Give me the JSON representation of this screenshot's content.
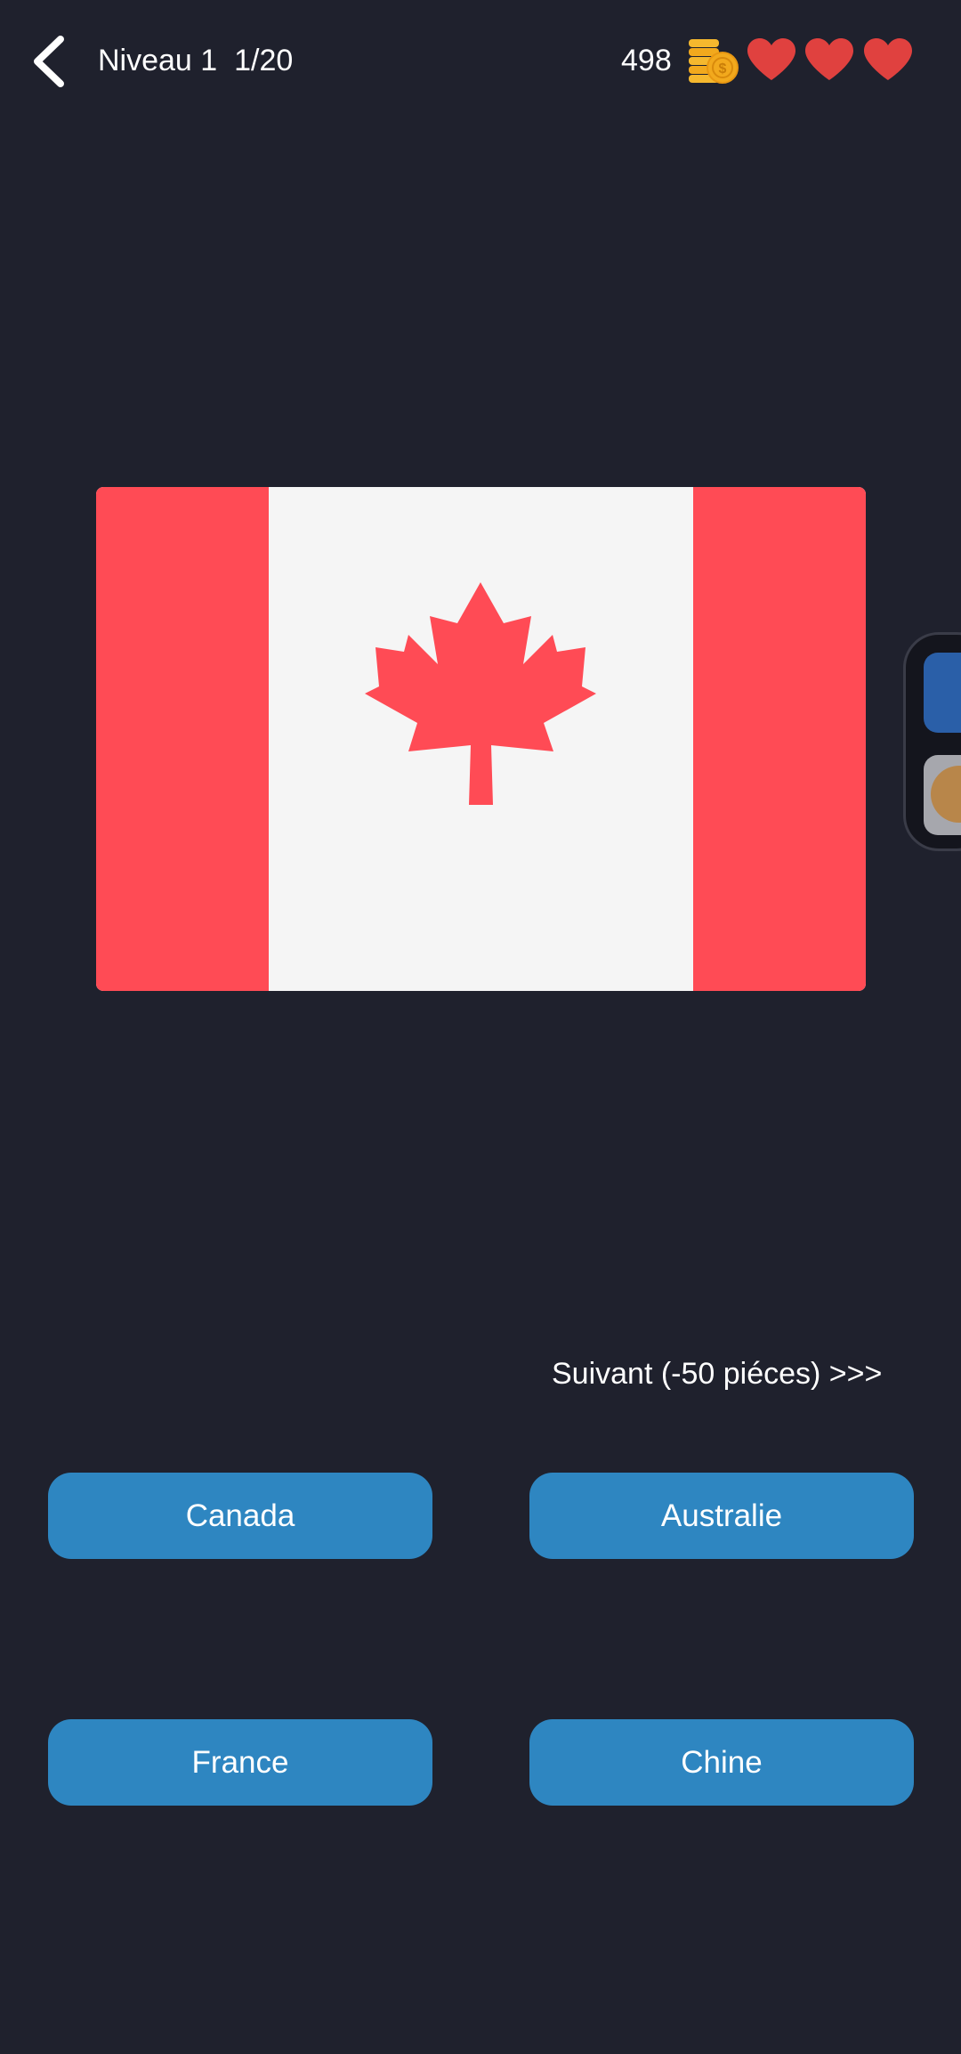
{
  "header": {
    "level": "Niveau 1",
    "progress": "1/20",
    "coins": "498",
    "coins_icon": "coins-icon",
    "lives": 3,
    "heart_color": "#e0413f",
    "back_icon": "chevron-left-icon"
  },
  "question": {
    "flag": "canada-flag",
    "flag_colors": {
      "red": "#ff4b55",
      "white": "#f5f5f5"
    }
  },
  "next": {
    "label": "Suivant (-50 piéces) >>>"
  },
  "answers": [
    {
      "label": "Canada"
    },
    {
      "label": "Australie"
    },
    {
      "label": "France"
    },
    {
      "label": "Chine"
    }
  ],
  "theme": {
    "background": "#1f212d",
    "button": "#2e86c1"
  }
}
